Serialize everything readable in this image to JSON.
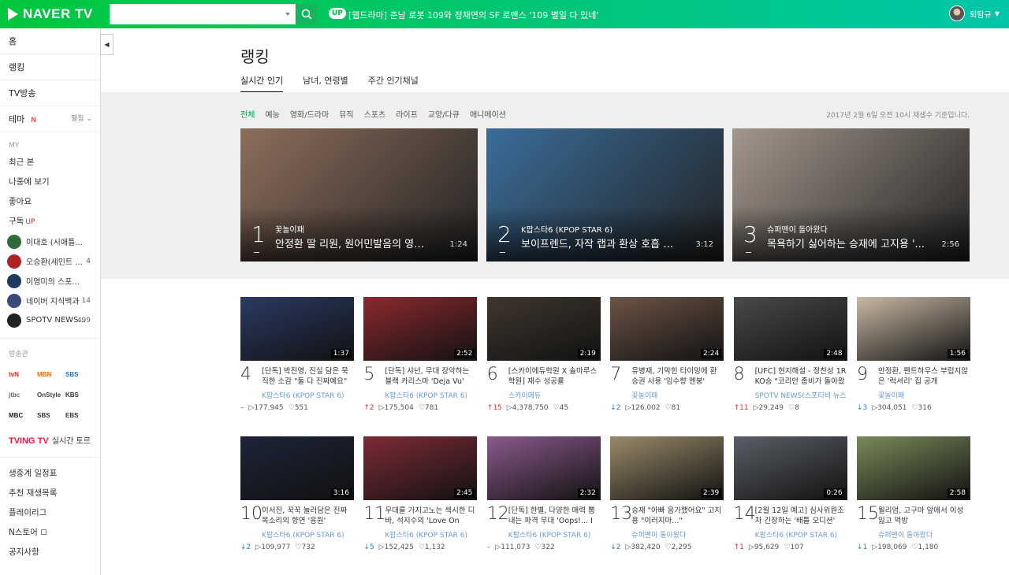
{
  "header": {
    "logo": "NAVER TV",
    "search_placeholder": "",
    "up_badge": "UP",
    "headline": "[웹드라마] 춘남 로봇 109와 정채연의 SF 로맨스 '109 별일 다 있네'",
    "user_name": "퇴탐규"
  },
  "sidebar": {
    "nav": [
      {
        "label": "홈"
      },
      {
        "label": "랭킹"
      },
      {
        "label": "TV방송"
      },
      {
        "label": "테마",
        "badge": "N",
        "fold": "펼침"
      }
    ],
    "my_label": "MY",
    "my_items": [
      "최근 본",
      "나중에 보기",
      "좋아요"
    ],
    "subscribe_label": "구독",
    "subscribe_badge": "UP",
    "subscriptions": [
      {
        "name": "이대호 (시애틀...",
        "count": "",
        "color": "#2f6b3a"
      },
      {
        "name": "오승환(세인트 ...",
        "count": "4",
        "color": "#b02323"
      },
      {
        "name": "이영미의 스포...",
        "count": "",
        "color": "#1e3a5c"
      },
      {
        "name": "네이버 지식백과",
        "count": "14",
        "color": "#3b4a7a"
      },
      {
        "name": "SPOTV NEWS...",
        "count": "499",
        "color": "#222"
      }
    ],
    "broadcaster_label": "방송관",
    "broadcasters": [
      {
        "name": "tvN",
        "color": "#e8261c"
      },
      {
        "name": "MBN",
        "color": "#f26c1b"
      },
      {
        "name": "SBS",
        "color": "#1b74bc"
      },
      {
        "name": "jtbc",
        "color": "#666"
      },
      {
        "name": "OnStyle",
        "color": "#444"
      },
      {
        "name": "KBS",
        "color": "#333"
      },
      {
        "name": "MBC",
        "color": "#222"
      },
      {
        "name": "SBS",
        "color": "#333"
      },
      {
        "name": "EBS",
        "color": "#333"
      }
    ],
    "tving_logo": "TVING TV",
    "tving_text": "실시간 토르",
    "bottom_links": [
      "생중계 일정표",
      "추천 재생목록",
      "플레이리그",
      "N스토어",
      "공지사항"
    ]
  },
  "main": {
    "title": "랭킹",
    "tabs": [
      "실시간 인기",
      "남녀, 연령별",
      "주간 인기채널"
    ],
    "categories": [
      "전체",
      "예능",
      "영화/드라마",
      "뮤직",
      "스포츠",
      "라이프",
      "교양/다큐",
      "애니메이션"
    ],
    "date_note": "2017년 2월 6일 오전 10시 재생수 기준입니다.",
    "top_cards": [
      {
        "rank": "1",
        "channel": "꽃놀이패",
        "title": "안정환 딸 리원, 원어민발음의 영어...",
        "duration": "1:24",
        "bg": "#8d6e5c"
      },
      {
        "rank": "2",
        "channel": "K팝스타6 (KPOP STAR 6)",
        "title": "보이프렌드, 자작 랩과 환상 호흡 돋...",
        "duration": "3:12",
        "bg": "#3a6d9a"
      },
      {
        "rank": "3",
        "channel": "슈퍼맨이 돌아왔다",
        "title": "목욕하기 싫어하는 승재에 고지용 '...",
        "duration": "2:56",
        "bg": "#a4978c"
      }
    ],
    "grid_cards": [
      {
        "rank": "4",
        "title": "[단독] 박진영, 진실 담은 묵직한 소감 \"둘 다 진짜예요\"",
        "channel": "K팝스타6 (KPOP STAR 6)",
        "change": "–",
        "change_type": "same",
        "plays": "▷177,945",
        "likes": "♡551",
        "duration": "1:37",
        "bg": "#2b3a63"
      },
      {
        "rank": "5",
        "title": "[단독] 샤넌, 무대 장악하는 블랙 카리스마 'Deja Vu'",
        "channel": "K팝스타6 (KPOP STAR 6)",
        "change": "↑2",
        "change_type": "up",
        "plays": "▷175,504",
        "likes": "♡781",
        "duration": "2:52",
        "bg": "#8c2a2f"
      },
      {
        "rank": "6",
        "title": "[스카이에듀학원 X 솔마루스학원] 재수 성공률",
        "channel": "스카이에듀",
        "change": "↑15",
        "change_type": "up",
        "plays": "▷4,378,750",
        "likes": "♡45",
        "duration": "2:19",
        "bg": "#40372e"
      },
      {
        "rank": "7",
        "title": "유병재, 기막힌 타이밍에 환승권 사용 '임수향 멘붕'",
        "channel": "꽃놀이패",
        "change": "↓2",
        "change_type": "down",
        "plays": "▷126,002",
        "likes": "♡81",
        "duration": "2:24",
        "bg": "#6d5446"
      },
      {
        "rank": "8",
        "title": "[UFC] 현지해설 - 정찬성 1R KO승 \"코리안 좀비가 돌아왔",
        "channel": "SPOTV NEWS(스포티비 뉴스)",
        "change": "↑11",
        "change_type": "up",
        "plays": "▷29,249",
        "likes": "♡8",
        "duration": "2:48",
        "bg": "#4a4a4a"
      },
      {
        "rank": "9",
        "title": "안정환, 펜트하우스 부럽지않은 '럭셔리' 집 공개",
        "channel": "꽃놀이패",
        "change": "↓3",
        "change_type": "down",
        "plays": "▷304,051",
        "likes": "♡316",
        "duration": "1:56",
        "bg": "#c9b9a4"
      },
      {
        "rank": "10",
        "title": "이서진, 꾹꾹 눌러담은 진짜목소리의 향연 '응원'",
        "channel": "K팝스타6 (KPOP STAR 6)",
        "change": "↓2",
        "change_type": "down",
        "plays": "▷109,977",
        "likes": "♡732",
        "duration": "3:16",
        "bg": "#1d2438"
      },
      {
        "rank": "11",
        "title": "무대를 가지고노는 섹시한 디바, 석지수의 'Love On",
        "channel": "K팝스타6 (KPOP STAR 6)",
        "change": "↓5",
        "change_type": "down",
        "plays": "▷152,425",
        "likes": "♡1,132",
        "duration": "2:45",
        "bg": "#7d2c36"
      },
      {
        "rank": "12",
        "title": "[단독] 한별, 다양한 매력 뽐내는 파격 무대 'Oops!... I",
        "channel": "K팝스타6 (KPOP STAR 6)",
        "change": "–",
        "change_type": "same",
        "plays": "▷111,073",
        "likes": "♡322",
        "duration": "2:32",
        "bg": "#8a5a8c"
      },
      {
        "rank": "13",
        "title": "승재 \"아빠 응가했어요\" 고지용 \"이러지마...\"",
        "channel": "슈퍼맨이 돌아왔다",
        "change": "↓2",
        "change_type": "down",
        "plays": "▷382,420",
        "likes": "♡2,295",
        "duration": "2:39",
        "bg": "#9a8a6a"
      },
      {
        "rank": "14",
        "title": "[2월 12일 예고] 심사위원조차 긴장하는 '배틀 오디션'",
        "channel": "K팝스타6 (KPOP STAR 6)",
        "change": "↑1",
        "change_type": "up",
        "plays": "▷95,629",
        "likes": "♡107",
        "duration": "0:26",
        "bg": "#5a5f66"
      },
      {
        "rank": "15",
        "title": "윌리엄, 고구마 앞에서 이성잃고 먹방",
        "channel": "슈퍼맨이 돌아왔다",
        "change": "↓1",
        "change_type": "down",
        "plays": "▷198,069",
        "likes": "♡1,180",
        "duration": "2:58",
        "bg": "#7a8a5a"
      }
    ]
  },
  "colors": {
    "brand_green": "#00c73c",
    "rank_up": "#e03131",
    "rank_down": "#2a78d0",
    "channel_link": "#6b9acf"
  }
}
